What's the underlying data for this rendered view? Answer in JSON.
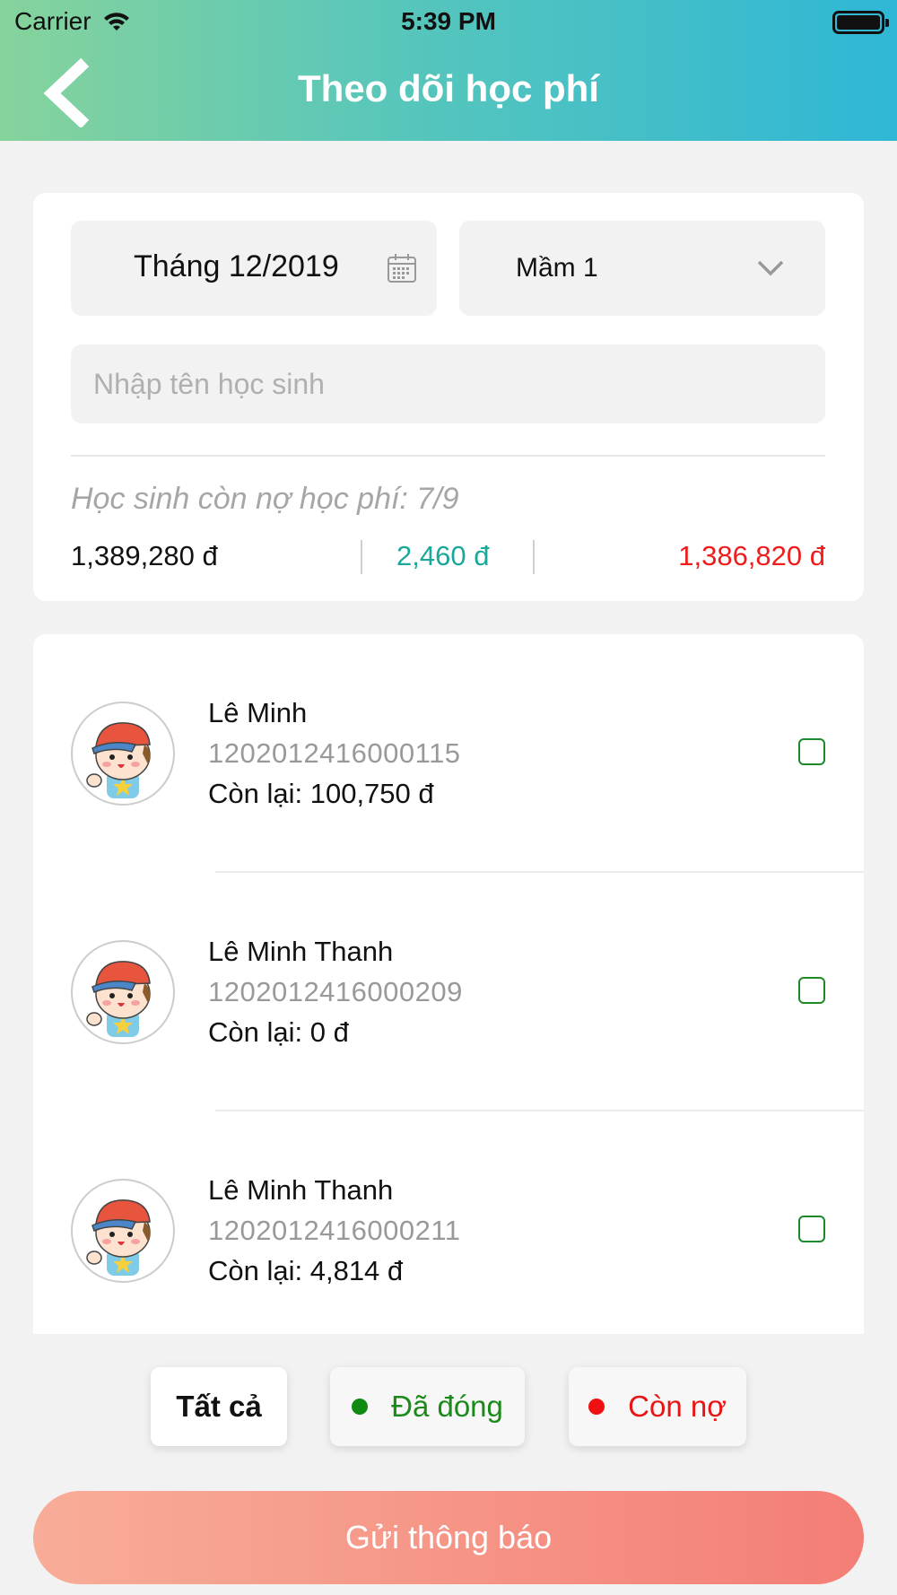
{
  "status_bar": {
    "carrier": "Carrier",
    "time": "5:39 PM"
  },
  "header": {
    "title": "Theo dõi học phí"
  },
  "filters": {
    "month": "Tháng 12/2019",
    "class": "Mầm 1",
    "search_placeholder": "Nhập tên học sinh"
  },
  "summary": {
    "debt_text": "Học sinh còn nợ học phí: 7/9",
    "total": "1,389,280 đ",
    "paid": "2,460 đ",
    "owed": "1,386,820 đ"
  },
  "students": [
    {
      "name": "Lê Minh",
      "code": "1202012416000115",
      "remaining": "Còn lại: 100,750 đ"
    },
    {
      "name": "Lê Minh Thanh",
      "code": "1202012416000209",
      "remaining": "Còn lại: 0 đ"
    },
    {
      "name": "Lê Minh Thanh",
      "code": "1202012416000211",
      "remaining": "Còn lại: 4,814 đ"
    }
  ],
  "status_filters": {
    "all": "Tất cả",
    "paid": "Đã đóng",
    "debt": "Còn nợ"
  },
  "send_button": "Gửi thông báo",
  "colors": {
    "header_gradient_start": "#86d39c",
    "header_gradient_end": "#2fb7d6",
    "paid_green": "#1aa89a",
    "owed_red": "#ee1c1c",
    "send_gradient_start": "#f8ad98",
    "send_gradient_end": "#f47e76"
  }
}
